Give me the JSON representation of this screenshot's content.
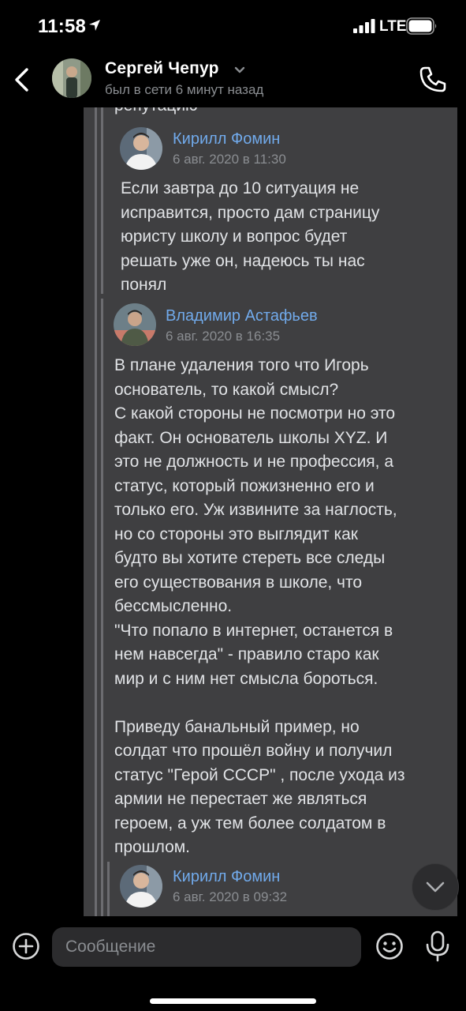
{
  "status_bar": {
    "time": "11:58",
    "network": "LTE"
  },
  "header": {
    "contact_name": "Сергей Чепур",
    "contact_status": "был в сети 6 минут назад"
  },
  "chat": {
    "cut_text": "репутацию",
    "forwards": [
      {
        "author": "Кирилл Фомин",
        "date": "6 авг. 2020 в 11:30",
        "text": "Если завтра до 10 ситуация не\nисправится, просто дам страницу\nюристу школу и вопрос будет\nрешать уже он, надеюсь ты нас\nпонял"
      },
      {
        "author": "Владимир Астафьев",
        "date": "6 авг. 2020 в 16:35",
        "text": "В плане удаления того что Игорь\nоснователь, то какой смысл?\nС какой стороны не посмотри но это\nфакт. Он основатель школы XYZ. И\nэто не должность и не профессия, а\nстатус, который пожизненно его и\nтолько его. Уж извините за наглость,\nно со стороны это выглядит как\nбудто вы хотите стереть все следы\nего существования в школе, что\nбессмысленно.\n\"Что попало в интернет, останется в\nнем навсегда\" - правило старо как\nмир и с ним нет смысла бороться.\n\nПриведу банальный пример, но\nсолдат что прошёл войну и получил\nстатус \"Герой СССР\" , после ухода из\nармии не перестает же являться\nгероем, а уж тем более солдатом в\nпрошлом."
      },
      {
        "author": "Кирилл Фомин",
        "date": "6 авг. 2020 в 09:32",
        "text": ""
      }
    ]
  },
  "composer": {
    "placeholder": "Сообщение"
  },
  "icons": {
    "back": "chevron-left-icon",
    "phone": "phone-icon",
    "attach": "plus-circle-icon",
    "emoji": "smile-icon",
    "mic": "microphone-icon",
    "scroll_down": "chevron-down-icon"
  },
  "colors": {
    "background": "#000000",
    "bubble": "#3f3f41",
    "author_link": "#71aaeb",
    "secondary_text": "#8a8d91",
    "primary_text": "#e1e3e6"
  }
}
